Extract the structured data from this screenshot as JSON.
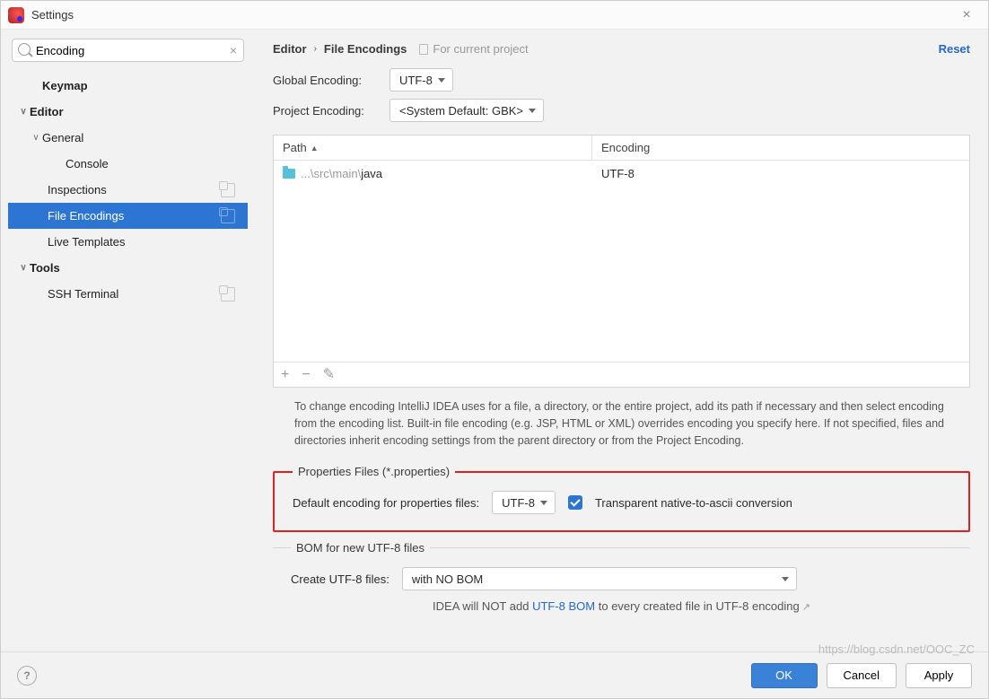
{
  "window": {
    "title": "Settings"
  },
  "search": {
    "value": "Encoding"
  },
  "tree": {
    "keymap": "Keymap",
    "editor": "Editor",
    "general": "General",
    "console": "Console",
    "inspections": "Inspections",
    "file_encodings": "File Encodings",
    "live_templates": "Live Templates",
    "tools": "Tools",
    "ssh_terminal": "SSH Terminal"
  },
  "breadcrumb": {
    "root": "Editor",
    "leaf": "File Encodings",
    "scope": "For current project",
    "reset": "Reset"
  },
  "globals": {
    "global_label": "Global Encoding:",
    "global_value": "UTF-8",
    "project_label": "Project Encoding:",
    "project_value": "<System Default: GBK>"
  },
  "table": {
    "head_path": "Path",
    "head_enc": "Encoding",
    "rows": [
      {
        "path_prefix": "...\\src\\main\\",
        "path_bold": "java",
        "encoding": "UTF-8"
      }
    ]
  },
  "help": "To change encoding IntelliJ IDEA uses for a file, a directory, or the entire project, add its path if necessary and then select encoding from the encoding list. Built-in file encoding (e.g. JSP, HTML or XML) overrides encoding you specify here. If not specified, files and directories inherit encoding settings from the parent directory or from the Project Encoding.",
  "properties": {
    "legend": "Properties Files (*.properties)",
    "label": "Default encoding for properties files:",
    "value": "UTF-8",
    "checkbox_label": "Transparent native-to-ascii conversion"
  },
  "bom": {
    "legend": "BOM for new UTF-8 files",
    "label": "Create UTF-8 files:",
    "value": "with NO BOM",
    "note_pre": "IDEA will NOT add ",
    "note_link": "UTF-8 BOM",
    "note_post": " to every created file in UTF-8 encoding"
  },
  "footer": {
    "ok": "OK",
    "cancel": "Cancel",
    "apply": "Apply"
  },
  "watermark": "https://blog.csdn.net/OOC_ZC"
}
